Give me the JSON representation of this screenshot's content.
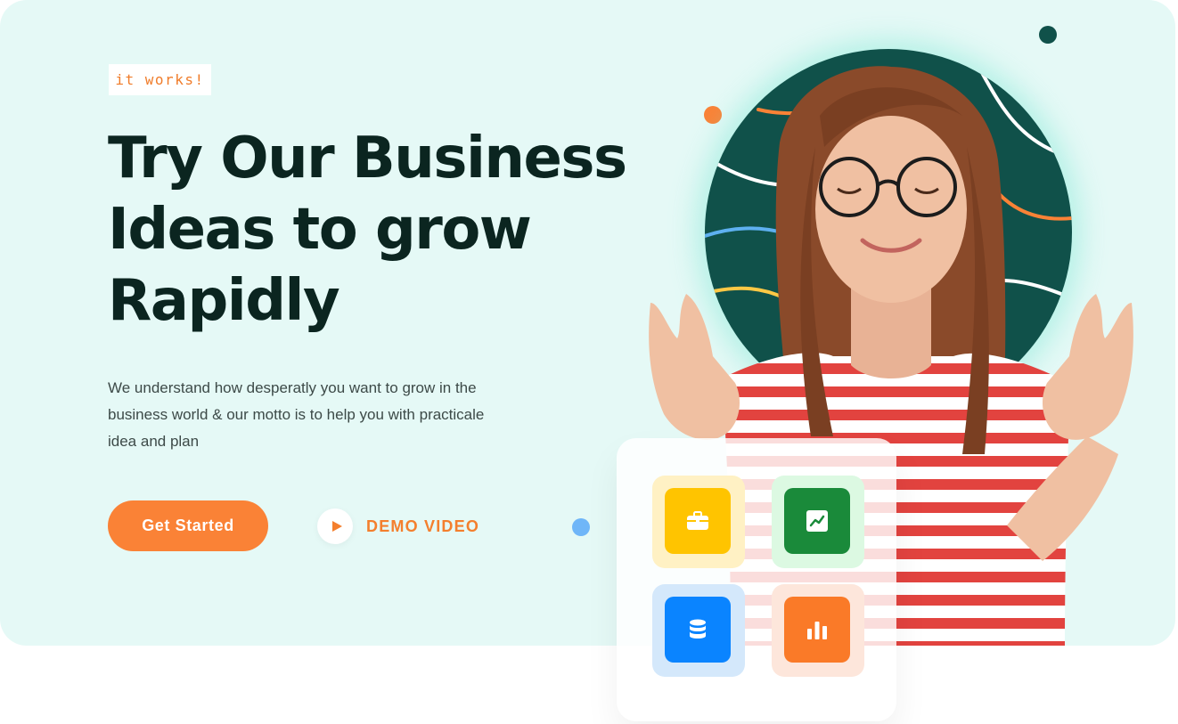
{
  "hero": {
    "badge": "it works!",
    "headline": [
      "Try Our Business",
      "Ideas to grow",
      "Rapidly"
    ],
    "description": "We understand how desperatly you want to grow in the business world & our motto is to help you with practicale idea and plan",
    "cta_label": "Get Started",
    "demo_label": "DEMO VIDEO"
  },
  "colors": {
    "background": "#e5f9f6",
    "accent": "#fa8236",
    "heading": "#0b2520",
    "circle": "#10514a"
  },
  "feature_icons": [
    {
      "name": "briefcase-icon",
      "color": "#ffc400"
    },
    {
      "name": "trend-chart-icon",
      "color": "#1a8a3a"
    },
    {
      "name": "database-icon",
      "color": "#0a84ff"
    },
    {
      "name": "bar-chart-icon",
      "color": "#fa7a28"
    }
  ]
}
